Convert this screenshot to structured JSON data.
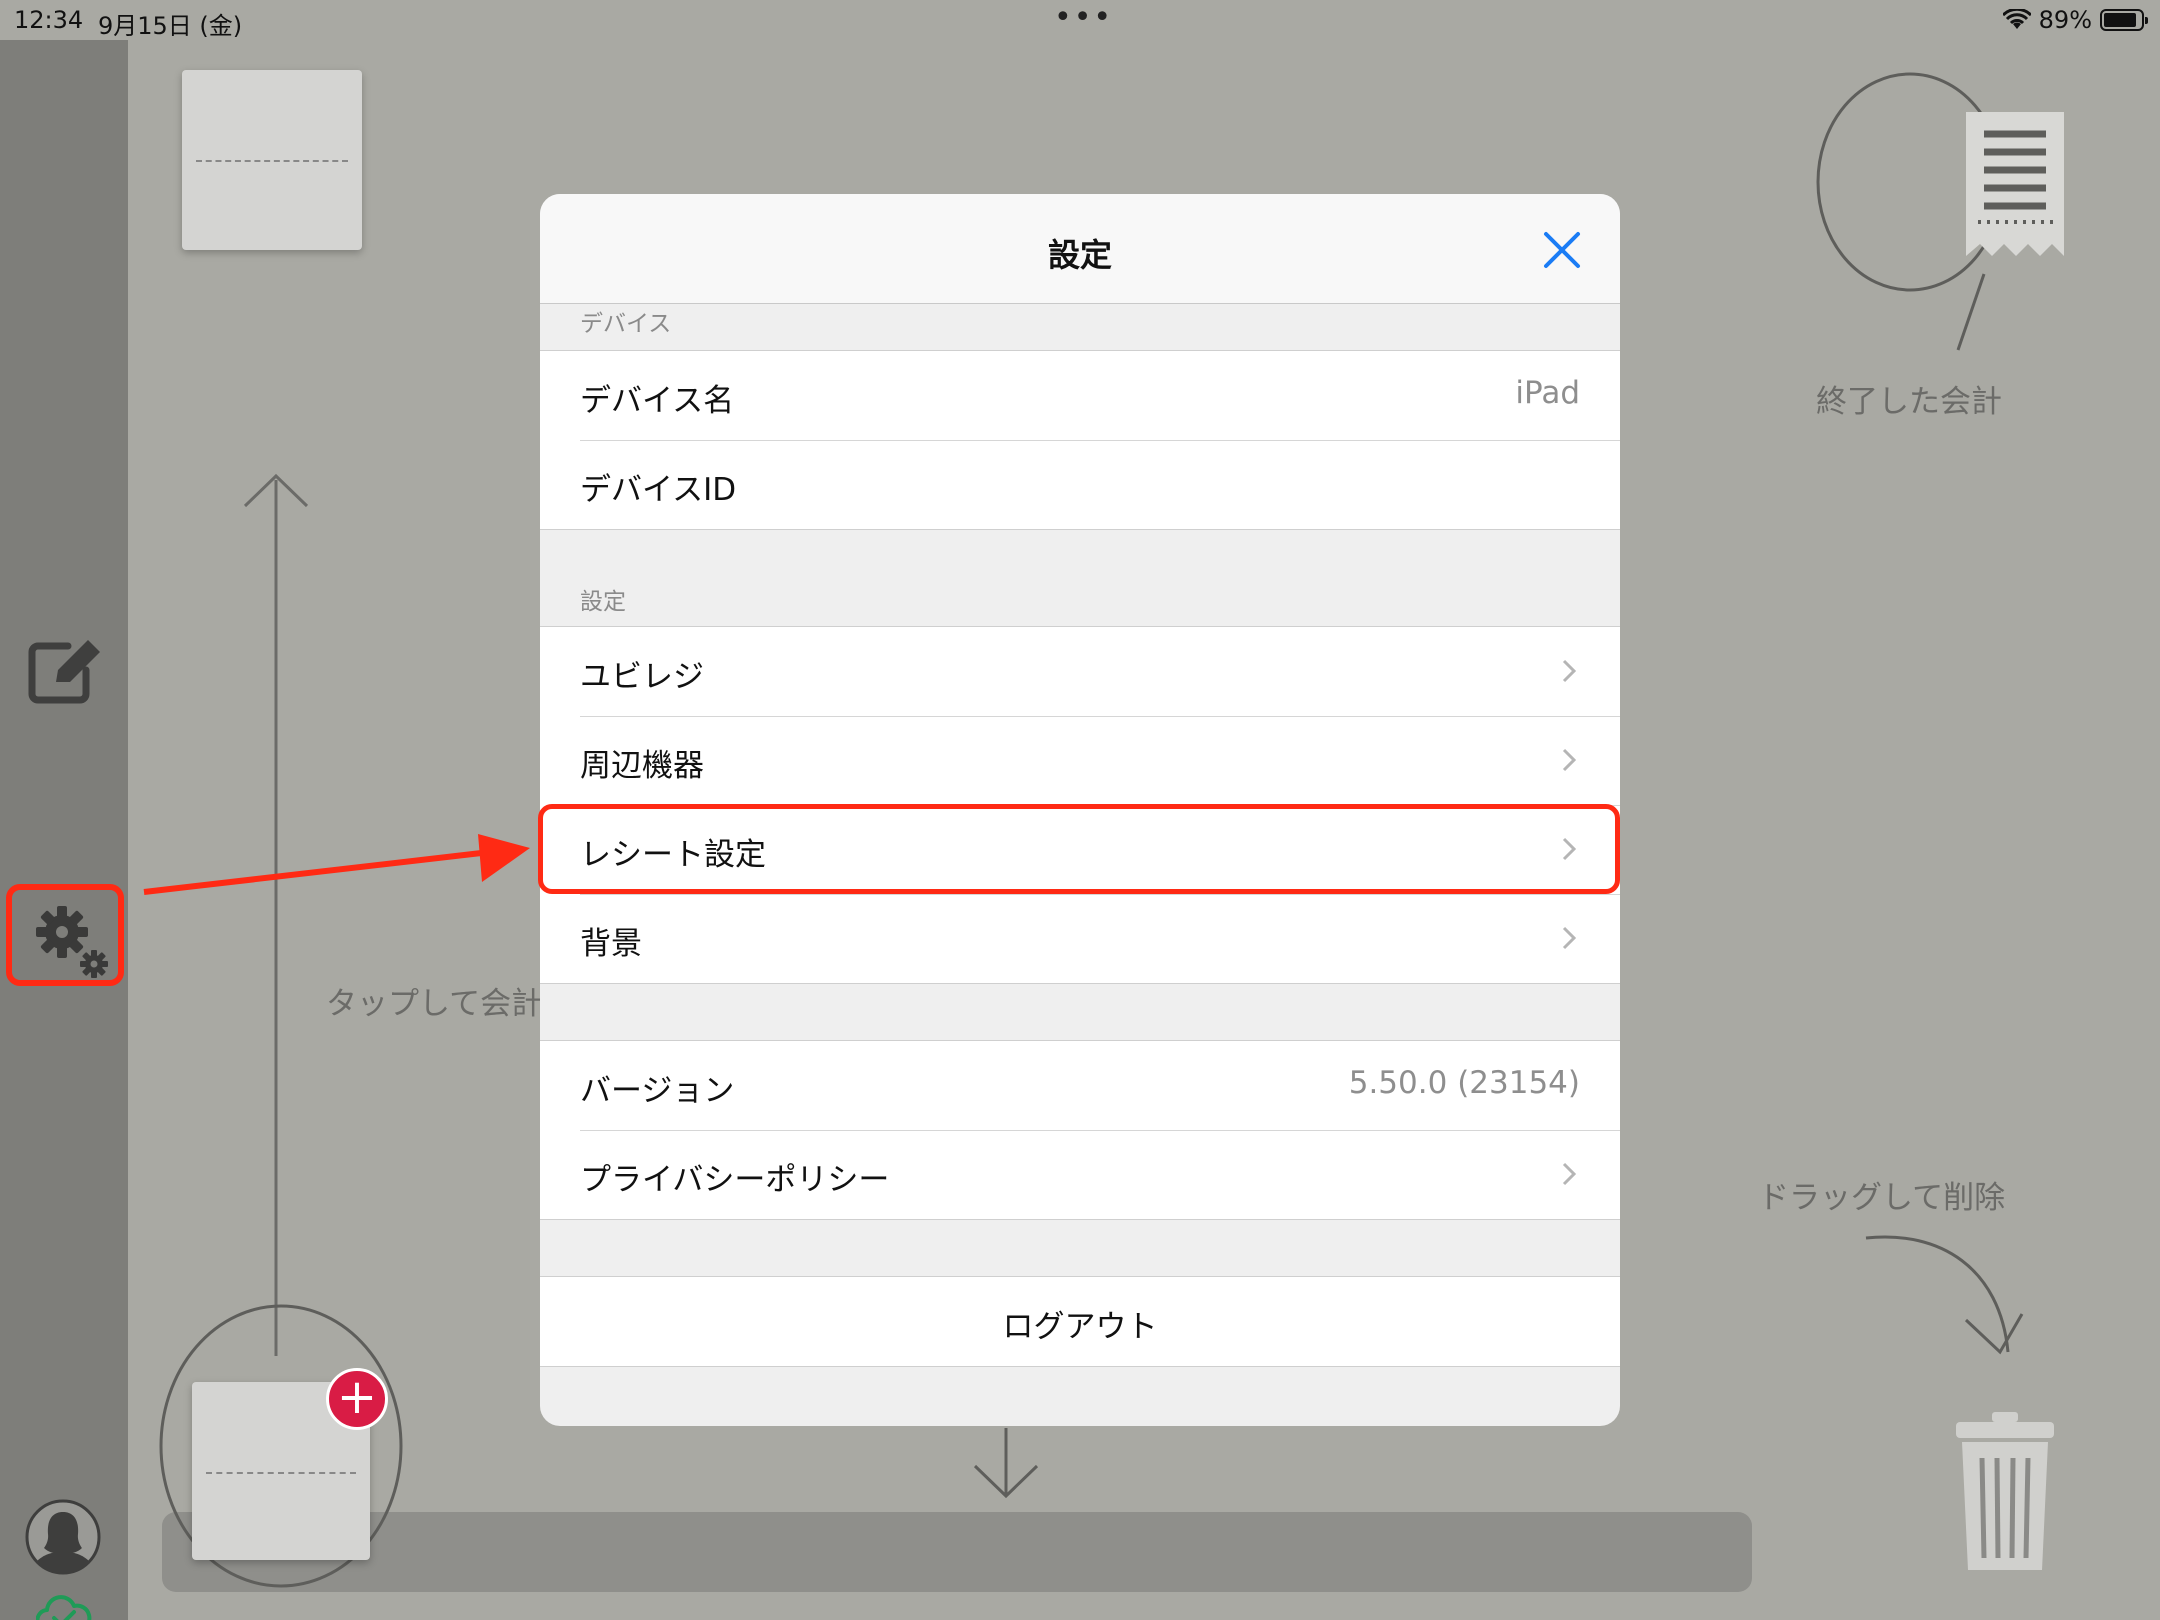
{
  "status_bar": {
    "time": "12:34",
    "date": "9月15日 (金)",
    "battery": "89%",
    "battery_level": 0.89
  },
  "background": {
    "label_tap": "タップして会計",
    "label_finished": "終了した会計",
    "label_drag_delete": "ドラッグして削除"
  },
  "modal": {
    "title": "設定",
    "sections": {
      "device": {
        "header": "デバイス",
        "device_name_label": "デバイス名",
        "device_name_value": "iPad",
        "device_id_label": "デバイスID"
      },
      "settings": {
        "header": "設定",
        "ubiregi": "ユビレジ",
        "peripherals": "周辺機器",
        "receipt": "レシート設定",
        "background": "背景"
      },
      "about": {
        "version_label": "バージョン",
        "version_value": "5.50.0 (23154)",
        "privacy": "プライバシーポリシー"
      },
      "logout": "ログアウト"
    }
  },
  "colors": {
    "accent": "#1a7cf5",
    "highlight": "#ff2a14",
    "badge": "#d91c45"
  },
  "icons": [
    "edit-icon",
    "gear-icon",
    "avatar-icon",
    "cloud-check-icon",
    "receipt-icon",
    "trash-icon",
    "close-icon",
    "chevron-right-icon",
    "wifi-icon",
    "battery-icon"
  ]
}
